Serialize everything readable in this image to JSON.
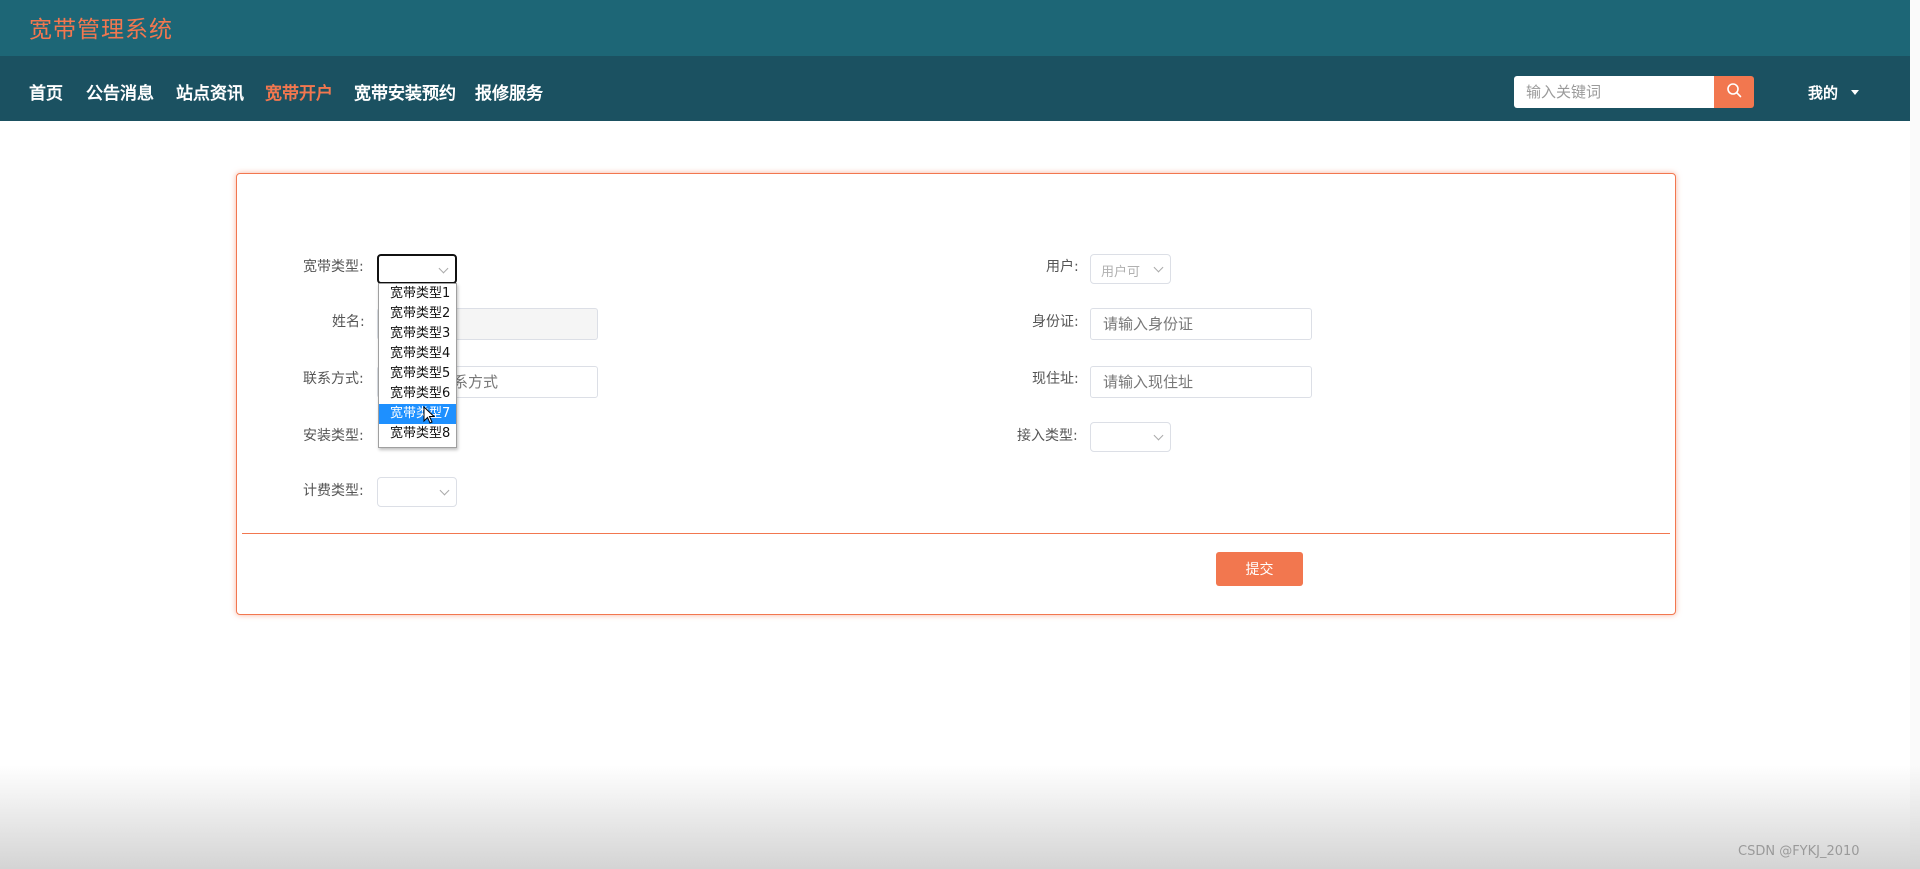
{
  "app": {
    "title": "宽带管理系统"
  },
  "nav": {
    "items": [
      {
        "label": "首页",
        "active": false
      },
      {
        "label": "公告消息",
        "active": false
      },
      {
        "label": "站点资讯",
        "active": false
      },
      {
        "label": "宽带开户",
        "active": true
      },
      {
        "label": "宽带安装预约",
        "active": false
      },
      {
        "label": "报修服务",
        "active": false
      }
    ],
    "search_placeholder": "输入关键词",
    "my_menu": "我的"
  },
  "form": {
    "broadband_type": {
      "label": "宽带类型:",
      "value": ""
    },
    "name": {
      "label": "姓名:",
      "value": ""
    },
    "contact": {
      "label": "联系方式:",
      "placeholder": "请输入联系方式",
      "visible_text": "系方式"
    },
    "install_type": {
      "label": "安装类型:"
    },
    "billing_type": {
      "label": "计费类型:",
      "value": ""
    },
    "user": {
      "label": "用户:",
      "value": "用户可"
    },
    "id_card": {
      "label": "身份证:",
      "placeholder": "请输入身份证"
    },
    "address": {
      "label": "现住址:",
      "placeholder": "请输入现住址"
    },
    "access_type": {
      "label": "接入类型:",
      "value": ""
    },
    "submit_label": "提交"
  },
  "dropdown": {
    "options": [
      "宽带类型1",
      "宽带类型2",
      "宽带类型3",
      "宽带类型4",
      "宽带类型5",
      "宽带类型6",
      "宽带类型7",
      "宽带类型8"
    ],
    "highlighted_index": 6
  },
  "watermark": "CSDN @FYKJ_2010",
  "colors": {
    "header_top": "#1d6676",
    "header_nav": "#1b5161",
    "accent": "#f2774f",
    "highlight": "#1e90ff"
  }
}
